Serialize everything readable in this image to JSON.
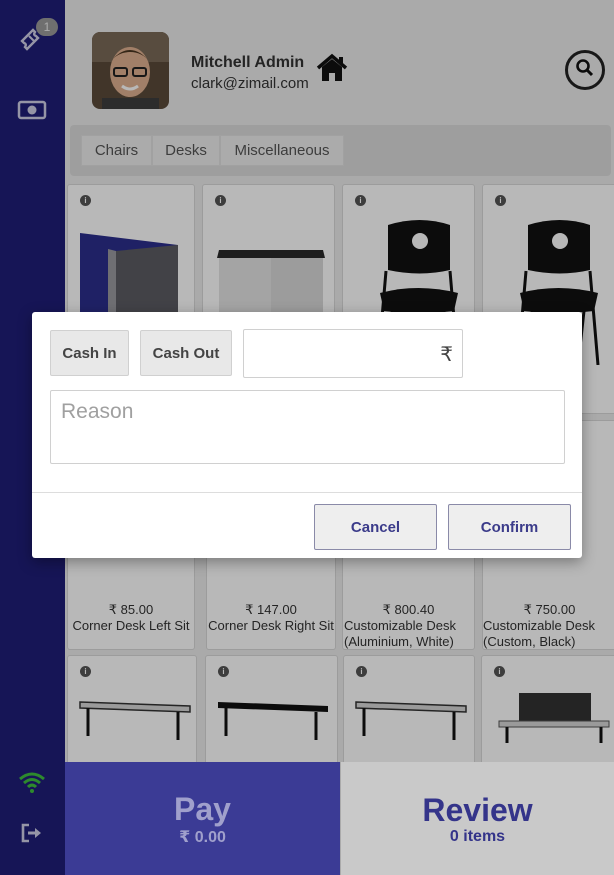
{
  "sidebar": {
    "ticket_badge": "1",
    "icons": [
      "ticket-icon",
      "cash-icon",
      "wifi-icon",
      "sign-out-icon"
    ]
  },
  "header": {
    "user_name": "Mitchell Admin",
    "user_email": "clark@zimail.com"
  },
  "categories": [
    "Chairs",
    "Desks",
    "Miscellaneous"
  ],
  "products": [
    {
      "price": "",
      "name": ""
    },
    {
      "price": "",
      "name": ""
    },
    {
      "price": "",
      "name": ""
    },
    {
      "price": "",
      "name": ""
    },
    {
      "price": "₹ 85.00",
      "name": "Corner Desk Left Sit"
    },
    {
      "price": "₹ 147.00",
      "name": "Corner Desk Right Sit"
    },
    {
      "price": "₹ 800.40",
      "name": "Customizable Desk (Aluminium, White)"
    },
    {
      "price": "₹ 750.00",
      "name": "Customizable Desk (Custom, Black)"
    }
  ],
  "actions": {
    "pay_label": "Pay",
    "pay_amount": "₹ 0.00",
    "review_label": "Review",
    "review_count": "0 items"
  },
  "modal": {
    "cash_in_label": "Cash In",
    "cash_out_label": "Cash Out",
    "amount_value": "",
    "currency_symbol": "₹",
    "reason_placeholder": "Reason",
    "cancel_label": "Cancel",
    "confirm_label": "Confirm"
  },
  "colors": {
    "sidebar": "#1f1e78",
    "pay_button": "#3b3b95",
    "accent_text": "#34348a"
  }
}
